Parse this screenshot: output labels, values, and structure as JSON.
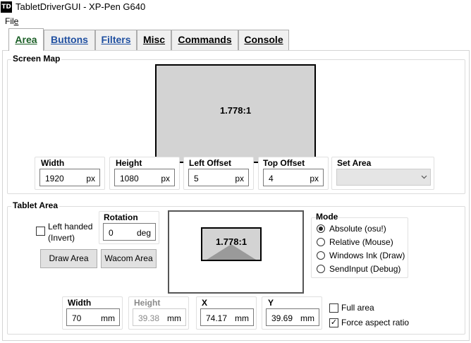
{
  "window": {
    "icon_text": "TD",
    "title": "TabletDriverGUI - XP-Pen G640"
  },
  "menu": {
    "file_pre": "Fil",
    "file_u": "e"
  },
  "tabs": [
    {
      "label": "Area"
    },
    {
      "label": "Buttons"
    },
    {
      "label": "Filters"
    },
    {
      "label": "Misc"
    },
    {
      "label": "Commands"
    },
    {
      "label": "Console"
    }
  ],
  "screen_map": {
    "title": "Screen Map",
    "ratio": "1.778:1",
    "width": {
      "label": "Width",
      "value": "1920",
      "unit": "px"
    },
    "height": {
      "label": "Height",
      "value": "1080",
      "unit": "px"
    },
    "left_offset": {
      "label": "Left Offset",
      "value": "5",
      "unit": "px"
    },
    "top_offset": {
      "label": "Top Offset",
      "value": "4",
      "unit": "px"
    },
    "set_area": {
      "label": "Set Area",
      "value": ""
    }
  },
  "tablet_area": {
    "title": "Tablet Area",
    "left_handed": {
      "label_line1": "Left handed",
      "label_line2": "(Invert)",
      "checked": false
    },
    "rotation": {
      "label": "Rotation",
      "value": "0",
      "unit": "deg"
    },
    "draw_area_button": "Draw Area",
    "wacom_area_button": "Wacom Area",
    "ratio": "1.778:1",
    "mode": {
      "label": "Mode",
      "options": [
        {
          "label": "Absolute (osu!)",
          "selected": true
        },
        {
          "label": "Relative (Mouse)",
          "selected": false
        },
        {
          "label": "Windows Ink (Draw)",
          "selected": false
        },
        {
          "label": "SendInput (Debug)",
          "selected": false
        }
      ]
    },
    "width": {
      "label": "Width",
      "value": "70",
      "unit": "mm"
    },
    "height": {
      "label": "Height",
      "value": "39.38",
      "unit": "mm"
    },
    "x": {
      "label": "X",
      "value": "74.17",
      "unit": "mm"
    },
    "y": {
      "label": "Y",
      "value": "39.69",
      "unit": "mm"
    },
    "full_area": {
      "label": "Full area",
      "checked": false
    },
    "force_aspect": {
      "label": "Force aspect ratio",
      "checked": true,
      "mark": "✓"
    }
  }
}
